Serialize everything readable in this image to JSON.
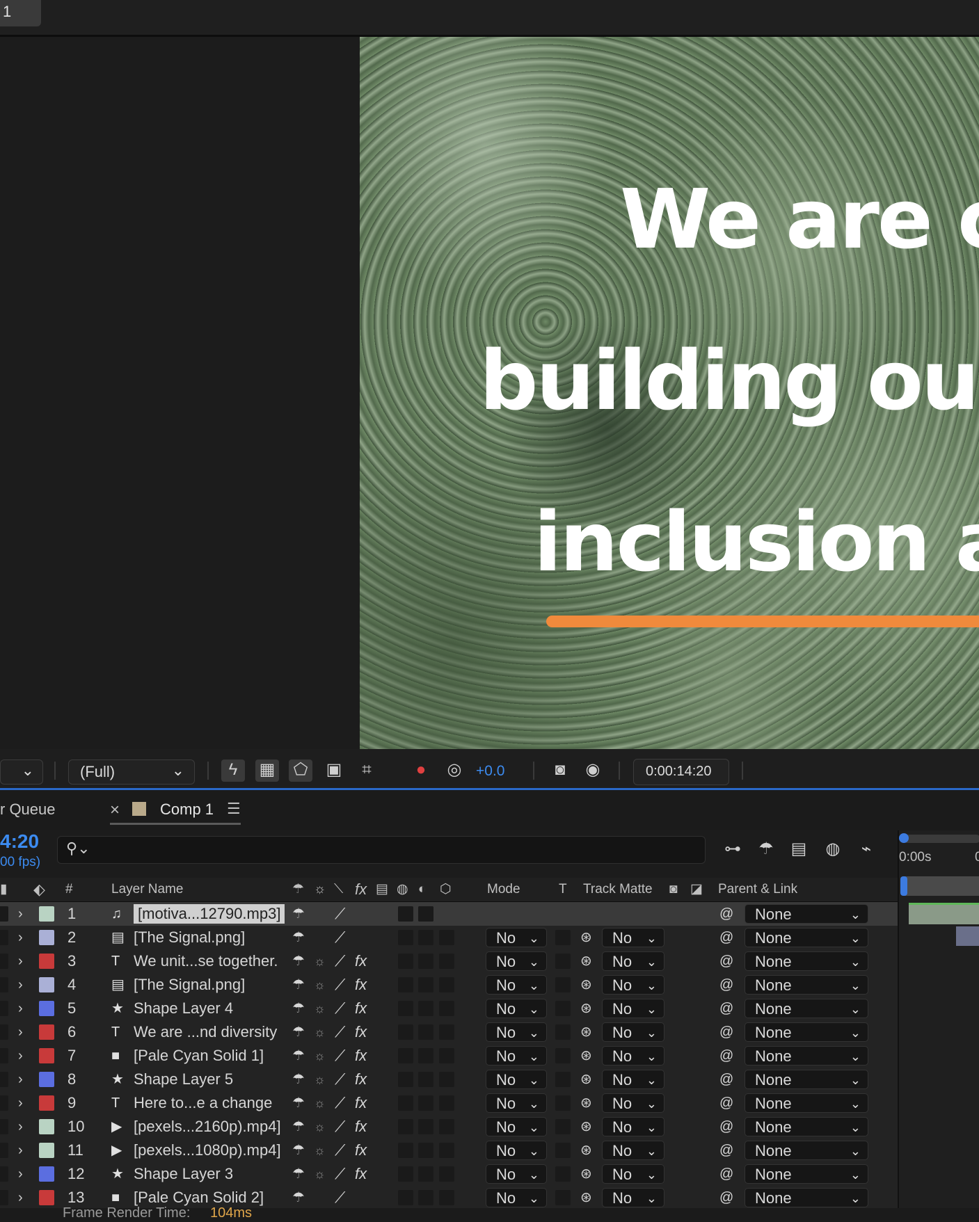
{
  "top": {
    "tab_label": "1"
  },
  "viewer": {
    "overlay_lines": [
      "We are c",
      "building ou",
      "inclusion a"
    ],
    "accent_bar_color": "#f08a3c"
  },
  "viewer_toolbar": {
    "resolution": "(Full)",
    "exposure": "+0.0",
    "timecode": "0:00:14:20"
  },
  "tabs": {
    "render_queue": "r Queue",
    "close": "×",
    "comp_name": "Comp 1",
    "menu": "☰"
  },
  "timeline": {
    "current_time": "4:20",
    "fps": "00 fps)",
    "ruler_start": "0:00s",
    "ruler_next": "0"
  },
  "columns": {
    "num": "#",
    "layer_name": "Layer Name",
    "fx": "fx",
    "mode": "Mode",
    "t": "T",
    "track_matte": "Track Matte",
    "parent_link": "Parent & Link"
  },
  "layers": [
    {
      "num": "1",
      "name": "[motiva...12790.mp3]",
      "color": "#b9d3c3",
      "icon": "audio-file-icon",
      "fx": false,
      "modes": false,
      "parent": "None"
    },
    {
      "num": "2",
      "name": "[The Signal.png]",
      "color": "#aab0d6",
      "icon": "image-file-icon",
      "fx": false,
      "modes": true,
      "parent": "None"
    },
    {
      "num": "3",
      "name": "We unit...se  together.",
      "color": "#c83a3a",
      "icon": "text-layer-icon",
      "fx": true,
      "modes": true,
      "parent": "None"
    },
    {
      "num": "4",
      "name": "[The Signal.png]",
      "color": "#aab0d6",
      "icon": "image-file-icon",
      "fx": true,
      "modes": true,
      "parent": "None"
    },
    {
      "num": "5",
      "name": "Shape Layer 4",
      "color": "#5b6ee0",
      "icon": "shape-layer-icon",
      "fx": true,
      "modes": true,
      "parent": "None"
    },
    {
      "num": "6",
      "name": "We are ...nd diversity",
      "color": "#c83a3a",
      "icon": "text-layer-icon",
      "fx": true,
      "modes": true,
      "parent": "None"
    },
    {
      "num": "7",
      "name": "[Pale Cyan Solid 1]",
      "color": "#c83a3a",
      "icon": "solid-layer-icon",
      "fx": true,
      "modes": true,
      "parent": "None"
    },
    {
      "num": "8",
      "name": "Shape Layer 5",
      "color": "#5b6ee0",
      "icon": "shape-layer-icon",
      "fx": true,
      "modes": true,
      "parent": "None"
    },
    {
      "num": "9",
      "name": "Here to...e a change",
      "color": "#c83a3a",
      "icon": "text-layer-icon",
      "fx": true,
      "modes": true,
      "parent": "None"
    },
    {
      "num": "10",
      "name": "[pexels...2160p).mp4]",
      "color": "#b9d3c3",
      "icon": "video-file-icon",
      "fx": true,
      "modes": true,
      "parent": "None"
    },
    {
      "num": "11",
      "name": "[pexels...1080p).mp4]",
      "color": "#b9d3c3",
      "icon": "video-file-icon",
      "fx": true,
      "modes": true,
      "parent": "None"
    },
    {
      "num": "12",
      "name": "Shape Layer 3",
      "color": "#5b6ee0",
      "icon": "shape-layer-icon",
      "fx": true,
      "modes": true,
      "parent": "None"
    },
    {
      "num": "13",
      "name": "[Pale Cyan Solid 2]",
      "color": "#c83a3a",
      "icon": "solid-layer-icon",
      "fx": false,
      "modes": true,
      "parent": "None"
    }
  ],
  "mode_value": "No",
  "matte_value": "No",
  "footer": {
    "label": "Frame Render Time:",
    "value": "104ms"
  }
}
